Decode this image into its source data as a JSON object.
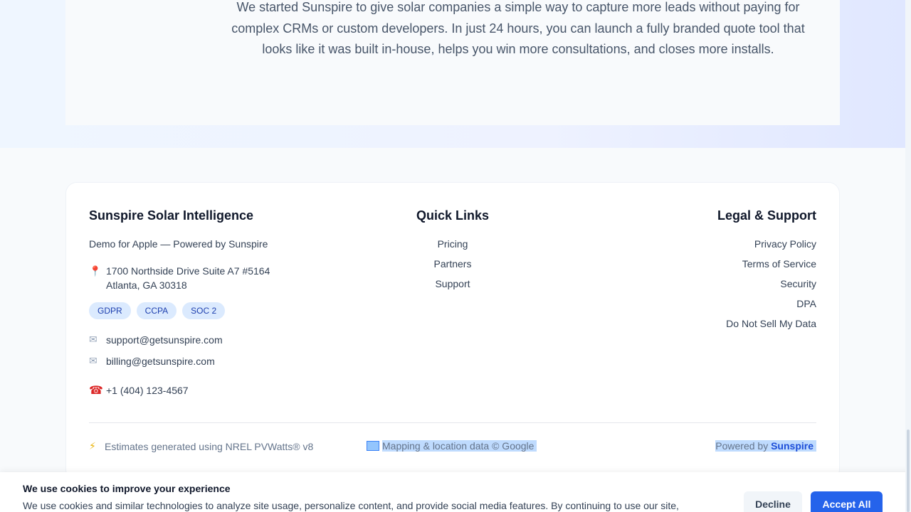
{
  "hero": {
    "text": "We started Sunspire to give solar companies a simple way to capture more leads without paying for complex CRMs or custom developers. In just 24 hours, you can launch a fully branded quote tool that looks like it was built in-house, helps you win more consultations, and closes more installs."
  },
  "footer": {
    "brand": {
      "title": "Sunspire Solar Intelligence",
      "tagline": "Demo for Apple — Powered by Sunspire",
      "address_line1": "1700 Northside Drive Suite A7 #5164",
      "address_line2": "Atlanta, GA 30318",
      "badges": [
        "GDPR",
        "CCPA",
        "SOC 2"
      ],
      "email_support": "support@getsunspire.com",
      "email_billing": "billing@getsunspire.com",
      "phone": "+1 (404) 123-4567"
    },
    "quick_links": {
      "title": "Quick Links",
      "items": [
        "Pricing",
        "Partners",
        "Support"
      ]
    },
    "legal": {
      "title": "Legal & Support",
      "items": [
        "Privacy Policy",
        "Terms of Service",
        "Security",
        "DPA",
        "Do Not Sell My Data"
      ]
    },
    "bottom": {
      "estimates": "Estimates generated using NREL PVWatts® v8",
      "mapping": "Mapping & location data © Google",
      "powered_prefix": "Powered by ",
      "powered_brand": "Sunspire"
    }
  },
  "cookie": {
    "title": "We use cookies to improve your experience",
    "body": "We use cookies and similar technologies to analyze site usage, personalize content, and provide social media features. By continuing to use our site,",
    "decline_label": "Decline",
    "accept_label": "Accept All"
  },
  "icons": {
    "pin": "map-pin-icon",
    "mail": "mail-icon",
    "phone": "phone-icon",
    "bolt": "lightning-icon",
    "map": "map-icon"
  },
  "colors": {
    "accent": "#2563eb",
    "badge_bg": "#dbeafe",
    "badge_text": "#1e40af",
    "heading": "#0f172a"
  }
}
